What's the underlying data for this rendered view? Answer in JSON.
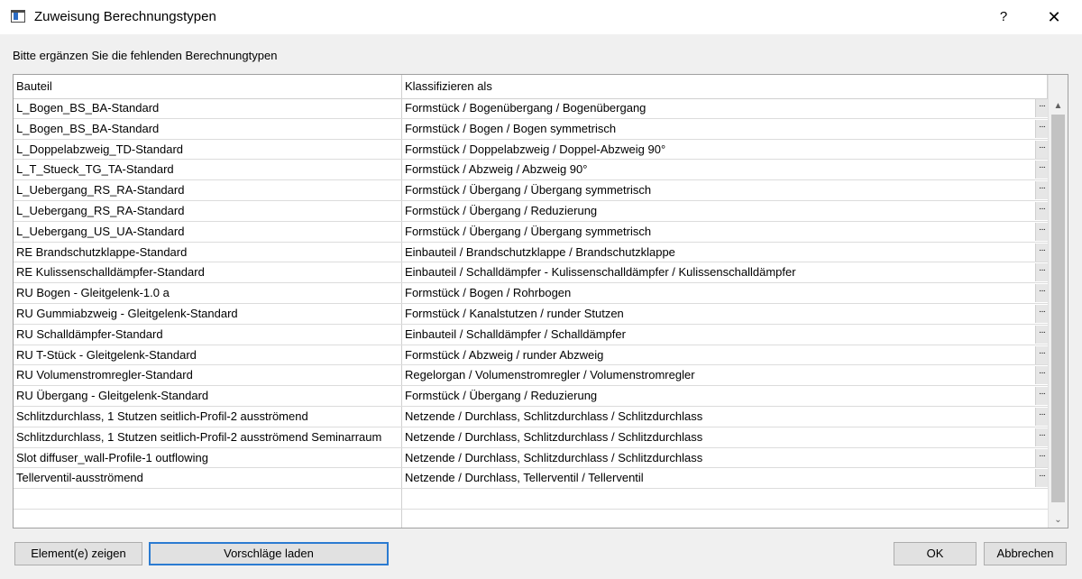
{
  "window": {
    "title": "Zuweisung Berechnungstypen",
    "help_label": "?",
    "close_label": "✕"
  },
  "instruction": "Bitte ergänzen Sie die fehlenden Berechnungtypen",
  "table": {
    "headers": [
      "Bauteil",
      "Klassifizieren als"
    ],
    "ellipsis": "···",
    "rows": [
      {
        "bauteil": "L_Bogen_BS_BA-Standard",
        "klass": "Formstück / Bogenübergang / Bogenübergang"
      },
      {
        "bauteil": "L_Bogen_BS_BA-Standard",
        "klass": "Formstück / Bogen / Bogen symmetrisch"
      },
      {
        "bauteil": "L_Doppelabzweig_TD-Standard",
        "klass": "Formstück / Doppelabzweig / Doppel-Abzweig 90°"
      },
      {
        "bauteil": "L_T_Stueck_TG_TA-Standard",
        "klass": "Formstück / Abzweig / Abzweig 90°"
      },
      {
        "bauteil": "L_Uebergang_RS_RA-Standard",
        "klass": "Formstück / Übergang / Übergang symmetrisch"
      },
      {
        "bauteil": "L_Uebergang_RS_RA-Standard",
        "klass": "Formstück / Übergang / Reduzierung"
      },
      {
        "bauteil": "L_Uebergang_US_UA-Standard",
        "klass": "Formstück / Übergang / Übergang symmetrisch"
      },
      {
        "bauteil": "RE Brandschutzklappe-Standard",
        "klass": "Einbauteil / Brandschutzklappe / Brandschutzklappe"
      },
      {
        "bauteil": "RE Kulissenschalldämpfer-Standard",
        "klass": "Einbauteil / Schalldämpfer - Kulissenschalldämpfer / Kulissenschalldämpfer"
      },
      {
        "bauteil": "RU Bogen - Gleitgelenk-1.0 a",
        "klass": "Formstück / Bogen / Rohrbogen"
      },
      {
        "bauteil": "RU Gummiabzweig - Gleitgelenk-Standard",
        "klass": "Formstück / Kanalstutzen / runder Stutzen"
      },
      {
        "bauteil": "RU Schalldämpfer-Standard",
        "klass": "Einbauteil / Schalldämpfer / Schalldämpfer"
      },
      {
        "bauteil": "RU T-Stück - Gleitgelenk-Standard",
        "klass": "Formstück / Abzweig / runder Abzweig"
      },
      {
        "bauteil": "RU Volumenstromregler-Standard",
        "klass": "Regelorgan / Volumenstromregler / Volumenstromregler"
      },
      {
        "bauteil": "RU Übergang - Gleitgelenk-Standard",
        "klass": "Formstück / Übergang / Reduzierung"
      },
      {
        "bauteil": "Schlitzdurchlass, 1 Stutzen seitlich-Profil-2 ausströmend",
        "klass": "Netzende / Durchlass, Schlitzdurchlass / Schlitzdurchlass"
      },
      {
        "bauteil": "Schlitzdurchlass, 1 Stutzen seitlich-Profil-2 ausströmend Seminarraum",
        "klass": "Netzende / Durchlass, Schlitzdurchlass / Schlitzdurchlass"
      },
      {
        "bauteil": "Slot diffuser_wall-Profile-1 outflowing",
        "klass": "Netzende / Durchlass, Schlitzdurchlass / Schlitzdurchlass"
      },
      {
        "bauteil": "Tellerventil-ausströmend",
        "klass": "Netzende / Durchlass, Tellerventil / Tellerventil"
      }
    ],
    "empty_rows": 2
  },
  "scrollbar": {
    "up_icon": "▲",
    "down_icon": "⌄"
  },
  "buttons": {
    "show_elements": "Element(e) zeigen",
    "load_suggestions": "Vorschläge laden",
    "ok": "OK",
    "cancel": "Abbrechen"
  },
  "colors": {
    "focus_border": "#2b7bd1",
    "thumb": "#c2c2c2"
  }
}
